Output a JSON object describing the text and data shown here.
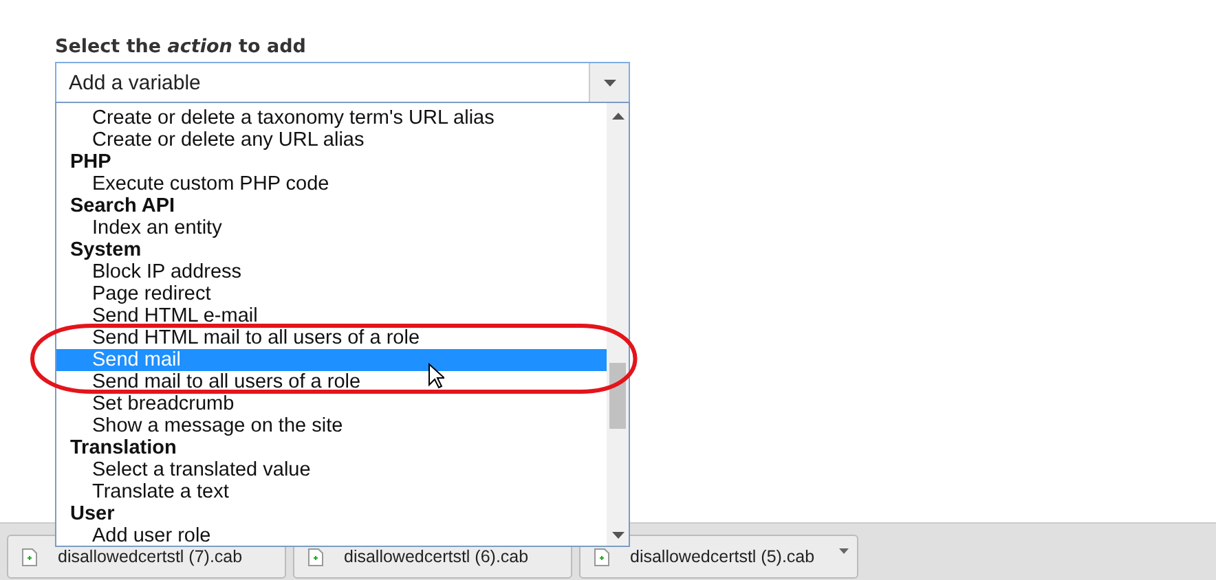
{
  "field_label": "Select the *action* to add",
  "select": {
    "value": "Add a variable",
    "expanded": true
  },
  "options": [
    {
      "kind": "option",
      "label": "Create or delete a taxonomy term's URL alias",
      "selected": false
    },
    {
      "kind": "option",
      "label": "Create or delete any URL alias",
      "selected": false
    },
    {
      "kind": "group",
      "label": "PHP",
      "selected": false
    },
    {
      "kind": "option",
      "label": "Execute custom PHP code",
      "selected": false
    },
    {
      "kind": "group",
      "label": "Search API",
      "selected": false
    },
    {
      "kind": "option",
      "label": "Index an entity",
      "selected": false
    },
    {
      "kind": "group",
      "label": "System",
      "selected": false
    },
    {
      "kind": "option",
      "label": "Block IP address",
      "selected": false
    },
    {
      "kind": "option",
      "label": "Page redirect",
      "selected": false
    },
    {
      "kind": "option",
      "label": "Send HTML e-mail",
      "selected": false
    },
    {
      "kind": "option",
      "label": "Send HTML mail to all users of a role",
      "selected": false
    },
    {
      "kind": "option",
      "label": "Send mail",
      "selected": true
    },
    {
      "kind": "option",
      "label": "Send mail to all users of a role",
      "selected": false
    },
    {
      "kind": "option",
      "label": "Set breadcrumb",
      "selected": false
    },
    {
      "kind": "option",
      "label": "Show a message on the site",
      "selected": false
    },
    {
      "kind": "group",
      "label": "Translation",
      "selected": false
    },
    {
      "kind": "option",
      "label": "Select a translated value",
      "selected": false
    },
    {
      "kind": "option",
      "label": "Translate a text",
      "selected": false
    },
    {
      "kind": "group",
      "label": "User",
      "selected": false
    },
    {
      "kind": "option",
      "label": "Add user role",
      "selected": false
    }
  ],
  "downloads": [
    {
      "name": "disallowedcertstl (7).cab"
    },
    {
      "name": "disallowedcertstl (6).cab"
    },
    {
      "name": "disallowedcertstl (5).cab"
    }
  ]
}
